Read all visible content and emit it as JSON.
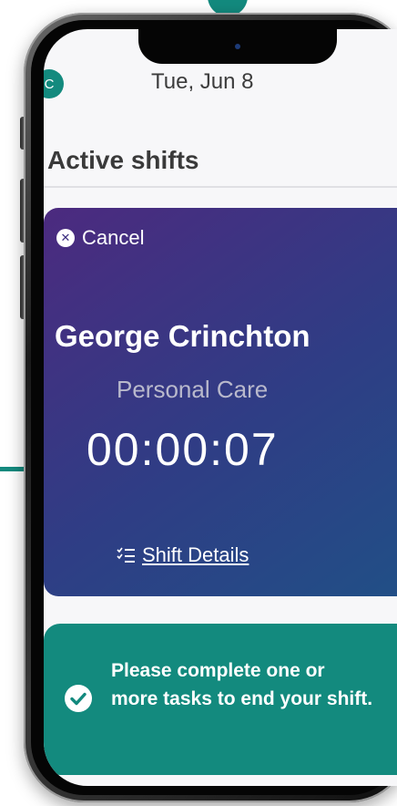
{
  "header": {
    "avatar_initial": "C",
    "date": "Tue, Jun 8"
  },
  "active_shifts": {
    "title": "Active shifts"
  },
  "shift_card": {
    "cancel_label": "Cancel",
    "client_name": "George Crinchton",
    "service": "Personal Care",
    "timer": "00:00:07",
    "details_label": "Shift Details"
  },
  "task_notice": {
    "message": "Please complete one or more tasks to end your shift."
  },
  "icons": {
    "cancel": "close-circle-icon",
    "details": "checklist-icon",
    "notice": "check-circle-icon"
  },
  "colors": {
    "accent_teal": "#138a7e",
    "card_purple": "#4c2a7f",
    "card_blue": "#214f86"
  }
}
